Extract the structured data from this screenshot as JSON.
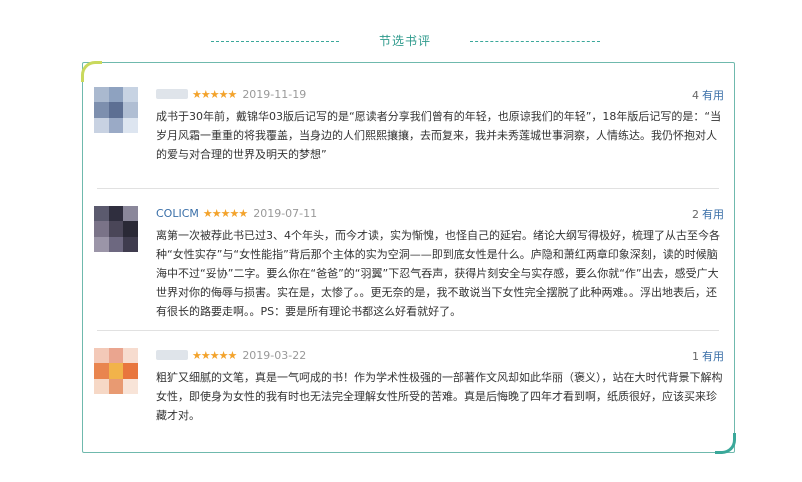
{
  "section_title": "节选书评",
  "colors": {
    "accent": "#2e9a8c",
    "panel_border": "#6fb9ad",
    "corner_highlight": "#c9d95d",
    "star": "#f3a32c",
    "link": "#3a6fa8"
  },
  "reviews": [
    {
      "username": "",
      "stars": "★★★★★",
      "date": "2019-11-19",
      "useful_count": "4",
      "useful_label": "有用",
      "avatar_icon": "avatar-pixelated",
      "avatar_colors": [
        "#aab9cf",
        "#8ea2c0",
        "#c7d3e3",
        "#7d8fae",
        "#5d6f93",
        "#b0bed3",
        "#c8d2e2",
        "#9aaac6",
        "#dde5f0"
      ],
      "text": "成书于30年前，戴锦华03版后记写的是“愿读者分享我们曾有的年轻，也原谅我们的年轻”，18年版后记写的是：“当岁月风霜一重重的将我覆盖，当身边的人们熙熙攘攘，去而复来，我并未秀莲城世事洞察，人情练达。我仍怀抱对人的爱与对合理的世界及明天的梦想”"
    },
    {
      "username": "COLICM",
      "stars": "★★★★★",
      "date": "2019-07-11",
      "useful_count": "2",
      "useful_label": "有用",
      "avatar_icon": "avatar-pixelated",
      "avatar_colors": [
        "#5b5a6e",
        "#2f2e3e",
        "#8a879a",
        "#7a7388",
        "#4a4658",
        "#2a2936",
        "#9b95a8",
        "#6d6880",
        "#3f3c4e"
      ],
      "text": "离第一次被荐此书已过3、4个年头，而今才读，实为惭愧，也怪自己的延宕。绪论大纲写得极好，梳理了从古至今各种“女性实存”与“女性能指”背后那个主体的实为空洞——即到底女性是什么。庐隐和萧红两章印象深刻，读的时候脑海中不过“妥协”二字。要么你在“爸爸”的“羽翼”下忍气吞声，获得片刻安全与实存感，要么你就“作”出去，感受广大世界对你的侮辱与损害。实在是，太惨了。。更无奈的是，我不敢说当下女性完全摆脱了此种两难。。浮出地表后，还有很长的路要走啊。。PS：要是所有理论书都这么好看就好了。"
    },
    {
      "username": "",
      "stars": "★★★★★",
      "date": "2019-03-22",
      "useful_count": "1",
      "useful_label": "有用",
      "avatar_icon": "avatar-pixelated",
      "avatar_colors": [
        "#f3c9b8",
        "#eaa58f",
        "#f7dccf",
        "#e9854f",
        "#f2b34a",
        "#e8763e",
        "#f6d8c6",
        "#e89a72",
        "#f8e4d8"
      ],
      "text": "粗犷又细腻的文笔，真是一气呵成的书！作为学术性极强的一部著作文风却如此华丽（褒义），站在大时代背景下解构女性，即使身为女性的我有时也无法完全理解女性所受的苦难。真是后悔晚了四年才看到啊，纸质很好，应该买来珍藏才对。"
    }
  ]
}
